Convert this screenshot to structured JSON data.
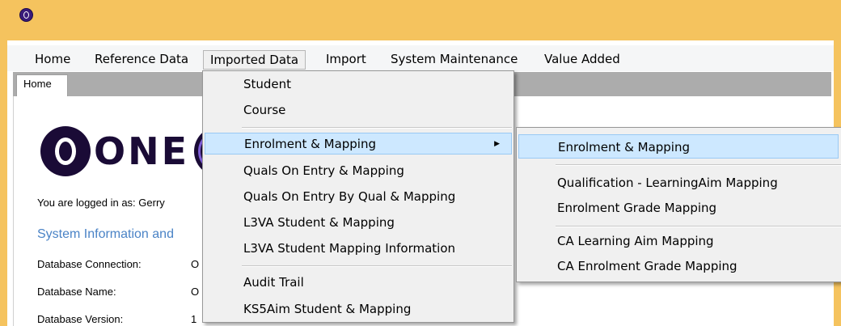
{
  "menubar": {
    "items": [
      "Home",
      "Reference Data",
      "Imported Data",
      "Import",
      "System Maintenance",
      "Value Added"
    ]
  },
  "tabs": [
    "Home"
  ],
  "home": {
    "logo_text": "ONE",
    "logged_in": "You are logged in as: Gerry",
    "system_info_heading": "System Information and",
    "rows": [
      {
        "label": "Database Connection:",
        "value": "O"
      },
      {
        "label": "Database Name:",
        "value": "O"
      },
      {
        "label": "Database Version:",
        "value": "1"
      }
    ]
  },
  "imported_data_menu": {
    "items": [
      "Student",
      "Course",
      "Enrolment & Mapping",
      "Quals On Entry & Mapping",
      "Quals On Entry By Qual & Mapping",
      "L3VA Student & Mapping",
      "L3VA Student Mapping Information",
      "Audit Trail",
      "KS5Aim Student & Mapping"
    ]
  },
  "enrolment_submenu": {
    "items": [
      "Enrolment & Mapping",
      "Qualification - LearningAim Mapping",
      "Enrolment Grade Mapping",
      "CA Learning Aim Mapping",
      "CA Enrolment Grade Mapping"
    ]
  },
  "colors": {
    "title_bar": "#f5c35e",
    "highlight": "#cde8ff",
    "heading": "#4a83c6",
    "logo": "#1a0b36"
  }
}
